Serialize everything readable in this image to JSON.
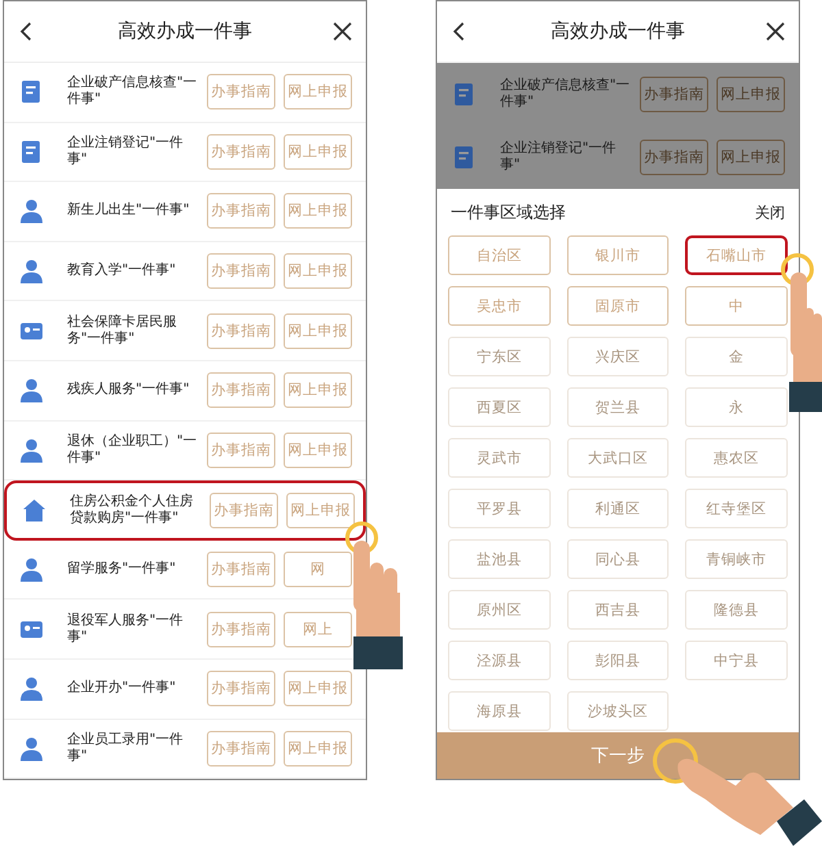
{
  "left_screen": {
    "title": "高效办成一件事",
    "items": [
      {
        "name": "企业破产信息核查\"一件事\"",
        "guide": "办事指南",
        "apply": "网上申报",
        "highlighted": false
      },
      {
        "name": "企业注销登记\"一件事\"",
        "guide": "办事指南",
        "apply": "网上申报",
        "highlighted": false
      },
      {
        "name": "新生儿出生\"一件事\"",
        "guide": "办事指南",
        "apply": "网上申报",
        "highlighted": false
      },
      {
        "name": "教育入学\"一件事\"",
        "guide": "办事指南",
        "apply": "网上申报",
        "highlighted": false
      },
      {
        "name": "社会保障卡居民服务\"一件事\"",
        "guide": "办事指南",
        "apply": "网上申报",
        "highlighted": false
      },
      {
        "name": "残疾人服务\"一件事\"",
        "guide": "办事指南",
        "apply": "网上申报",
        "highlighted": false
      },
      {
        "name": "退休（企业职工）\"一件事\"",
        "guide": "办事指南",
        "apply": "网上申报",
        "highlighted": false
      },
      {
        "name": "住房公积金个人住房贷款购房\"一件事\"",
        "guide": "办事指南",
        "apply": "网上申报",
        "highlighted": true
      },
      {
        "name": "留学服务\"一件事\"",
        "guide": "办事指南",
        "apply": "网",
        "highlighted": false
      },
      {
        "name": "退役军人服务\"一件事\"",
        "guide": "办事指南",
        "apply": "网上",
        "highlighted": false
      },
      {
        "name": "企业开办\"一件事\"",
        "guide": "办事指南",
        "apply": "网上申报",
        "highlighted": false
      },
      {
        "name": "企业员工录用\"一件事\"",
        "guide": "办事指南",
        "apply": "网上申报",
        "highlighted": false
      }
    ]
  },
  "right_screen": {
    "title": "高效办成一件事",
    "items": [
      {
        "name": "企业破产信息核查\"一件事\"",
        "guide": "办事指南",
        "apply": "网上申报"
      },
      {
        "name": "企业注销登记\"一件事\"",
        "guide": "办事指南",
        "apply": "网上申报"
      }
    ],
    "panel_title": "一件事区域选择",
    "close": "关闭",
    "regions": [
      {
        "label": "自治区",
        "disabled": false,
        "highlighted": false
      },
      {
        "label": "银川市",
        "disabled": false,
        "highlighted": false
      },
      {
        "label": "石嘴山市",
        "disabled": false,
        "highlighted": true
      },
      {
        "label": "吴忠市",
        "disabled": false,
        "highlighted": false
      },
      {
        "label": "固原市",
        "disabled": false,
        "highlighted": false
      },
      {
        "label": "中",
        "disabled": false,
        "highlighted": false
      },
      {
        "label": "宁东区",
        "disabled": true,
        "highlighted": false
      },
      {
        "label": "兴庆区",
        "disabled": true,
        "highlighted": false
      },
      {
        "label": "金",
        "disabled": true,
        "highlighted": false
      },
      {
        "label": "西夏区",
        "disabled": true,
        "highlighted": false
      },
      {
        "label": "贺兰县",
        "disabled": true,
        "highlighted": false
      },
      {
        "label": "永",
        "disabled": true,
        "highlighted": false
      },
      {
        "label": "灵武市",
        "disabled": true,
        "highlighted": false
      },
      {
        "label": "大武口区",
        "disabled": true,
        "highlighted": false
      },
      {
        "label": "惠农区",
        "disabled": true,
        "highlighted": false
      },
      {
        "label": "平罗县",
        "disabled": true,
        "highlighted": false
      },
      {
        "label": "利通区",
        "disabled": true,
        "highlighted": false
      },
      {
        "label": "红寺堡区",
        "disabled": true,
        "highlighted": false
      },
      {
        "label": "盐池县",
        "disabled": true,
        "highlighted": false
      },
      {
        "label": "同心县",
        "disabled": true,
        "highlighted": false
      },
      {
        "label": "青铜峡市",
        "disabled": true,
        "highlighted": false
      },
      {
        "label": "原州区",
        "disabled": true,
        "highlighted": false
      },
      {
        "label": "西吉县",
        "disabled": true,
        "highlighted": false
      },
      {
        "label": "隆德县",
        "disabled": true,
        "highlighted": false
      },
      {
        "label": "泾源县",
        "disabled": true,
        "highlighted": false
      },
      {
        "label": "彭阳县",
        "disabled": true,
        "highlighted": false
      },
      {
        "label": "中宁县",
        "disabled": true,
        "highlighted": false
      },
      {
        "label": "海原县",
        "disabled": true,
        "highlighted": false
      },
      {
        "label": "沙坡头区",
        "disabled": true,
        "highlighted": false
      }
    ],
    "next": "下一步"
  }
}
